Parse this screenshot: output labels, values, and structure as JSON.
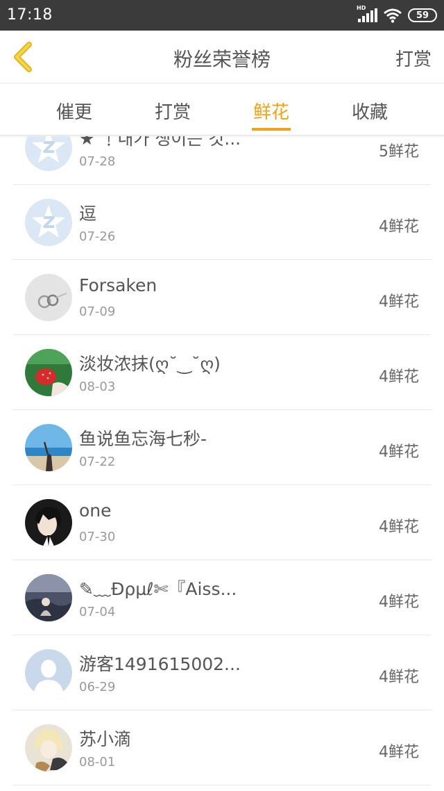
{
  "status": {
    "time": "17:18",
    "battery": "59",
    "signal_label": "HD"
  },
  "header": {
    "title": "粉丝荣誉榜",
    "tip_button": "打赏"
  },
  "tabs": [
    {
      "label": "催更"
    },
    {
      "label": "打赏"
    },
    {
      "label": "鲜花"
    },
    {
      "label": "收藏"
    }
  ],
  "active_tab": "鲜花",
  "colors": {
    "accent": "#f0a21a",
    "status_bar": "#3b3b3b"
  },
  "fans": [
    {
      "name": "★ ﹗내가 생이는 것...",
      "date": "07-28",
      "count": "5鲜花",
      "avatar": "qq-default-avatar"
    },
    {
      "name": "逗",
      "date": "07-26",
      "count": "4鲜花",
      "avatar": "qq-default-avatar"
    },
    {
      "name": "Forsaken",
      "date": "07-09",
      "count": "4鲜花",
      "avatar": "rings-photo-avatar"
    },
    {
      "name": "淡妆浓抹(ღ˘‿˘ღ)",
      "date": "08-03",
      "count": "4鲜花",
      "avatar": "strawberry-photo-avatar"
    },
    {
      "name": "鱼说鱼忘海七秒-",
      "date": "07-22",
      "count": "4鲜花",
      "avatar": "beach-photo-avatar"
    },
    {
      "name": "one",
      "date": "07-30",
      "count": "4鲜花",
      "avatar": "anime-boy-avatar"
    },
    {
      "name": "✎﹏Ɖρµℓ✄『Aiss...",
      "date": "07-04",
      "count": "4鲜花",
      "avatar": "night-photo-avatar"
    },
    {
      "name": "游客1491615002...",
      "date": "06-29",
      "count": "4鲜花",
      "avatar": "guest-silhouette-avatar"
    },
    {
      "name": "苏小滴",
      "date": "08-01",
      "count": "4鲜花",
      "avatar": "anime-girl-avatar"
    }
  ]
}
